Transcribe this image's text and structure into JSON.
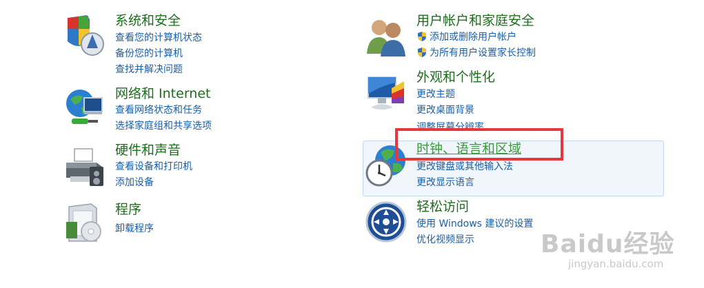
{
  "categories": {
    "system_security": {
      "title": "系统和安全",
      "links": [
        "查看您的计算机状态",
        "备份您的计算机",
        "查找并解决问题"
      ]
    },
    "network": {
      "title": "网络和 Internet",
      "links": [
        "查看网络状态和任务",
        "选择家庭组和共享选项"
      ]
    },
    "hardware": {
      "title": "硬件和声音",
      "links": [
        "查看设备和打印机",
        "添加设备"
      ]
    },
    "programs": {
      "title": "程序",
      "links": [
        "卸载程序"
      ]
    },
    "user_accounts": {
      "title": "用户帐户和家庭安全",
      "links": [
        "添加或删除用户帐户",
        "为所有用户设置家长控制"
      ]
    },
    "appearance": {
      "title": "外观和个性化",
      "links": [
        "更改主题",
        "更改桌面背景",
        "调整屏幕分辨率"
      ]
    },
    "clock_region": {
      "title": "时钟、语言和区域",
      "links": [
        "更改键盘或其他输入法",
        "更改显示语言"
      ]
    },
    "ease_of_access": {
      "title": "轻松访问",
      "links": [
        "使用 Windows 建议的设置",
        "优化视频显示"
      ]
    }
  },
  "watermark": {
    "logo_text": "Baidu经验",
    "url": "jingyan.baidu.com"
  },
  "colors": {
    "title_green": "#1e6d1e",
    "link_blue": "#1a5ea8",
    "highlight_bg": "#f1f6fd",
    "red_box": "#e8373a"
  }
}
